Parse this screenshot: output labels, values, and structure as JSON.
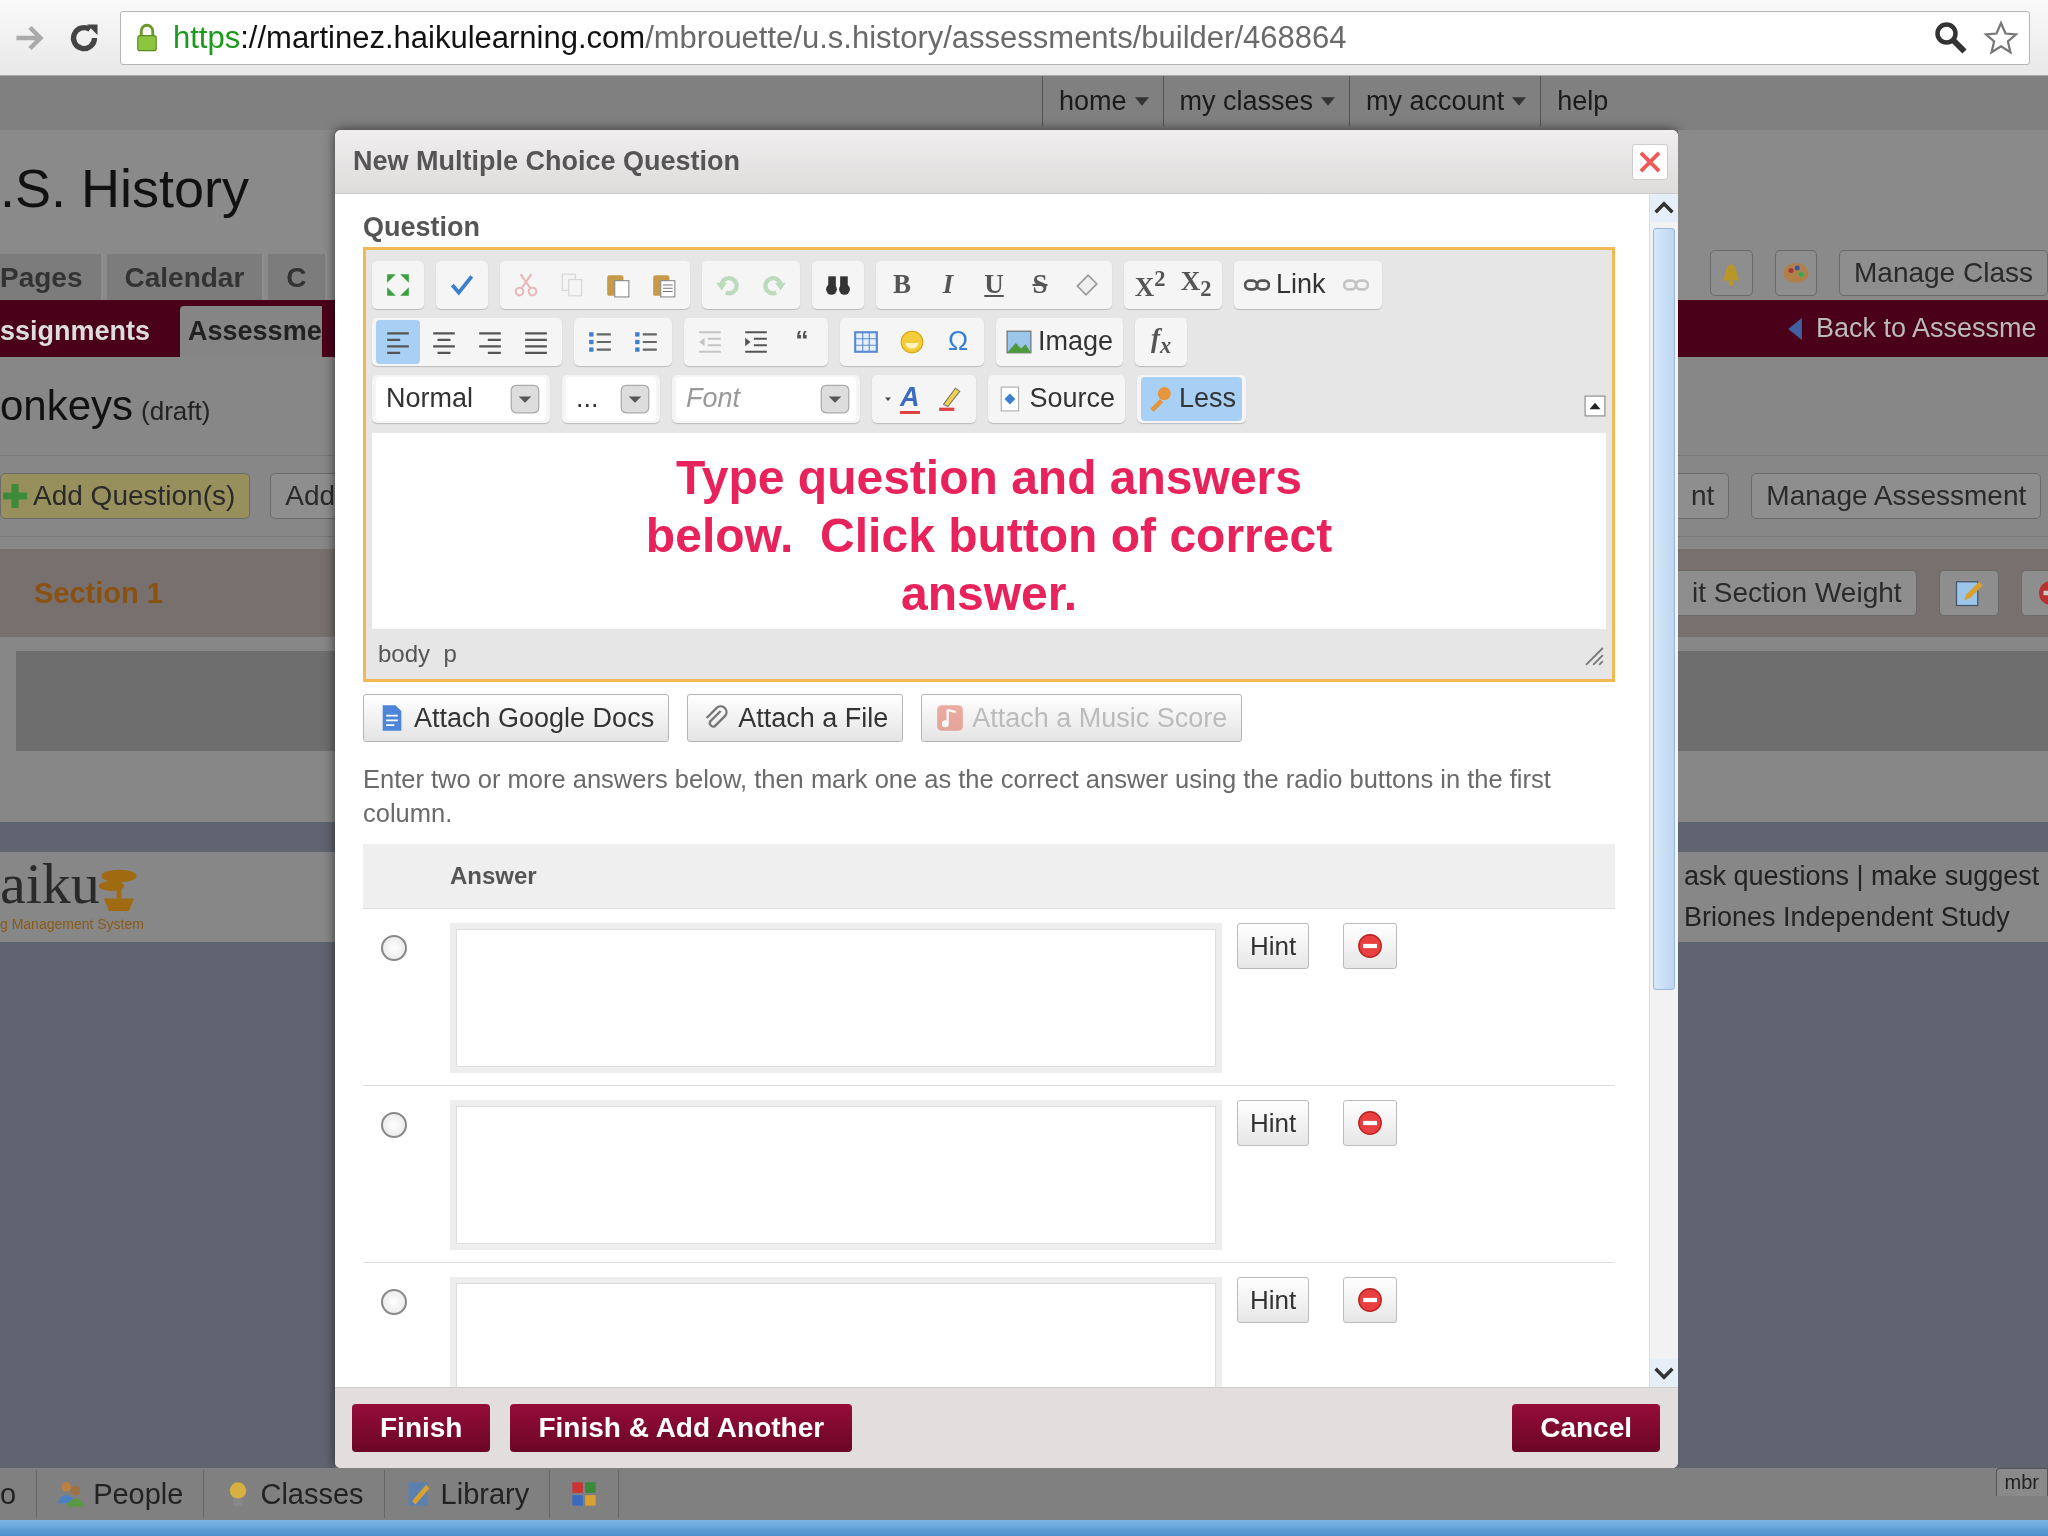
{
  "browser": {
    "url_parts": [
      {
        "text": "https",
        "kind": "scheme"
      },
      {
        "text": "://martinez.haikulearning.com",
        "kind": "host"
      },
      {
        "text": "/mbrouette/u.s.history/assessments/builder/468864",
        "kind": "path"
      }
    ]
  },
  "top_nav": [
    {
      "label": "home",
      "dropdown": true
    },
    {
      "label": "my classes",
      "dropdown": true
    },
    {
      "label": "my account",
      "dropdown": true
    },
    {
      "label": "help",
      "dropdown": false
    }
  ],
  "background": {
    "left": {
      "course_title": ".S. History",
      "tabs": [
        "Pages",
        "Calendar",
        "C"
      ],
      "subtabs": [
        {
          "label": "ssignments",
          "selected": false
        },
        {
          "label": "Assessme",
          "selected": true
        }
      ],
      "assessment_title": "onkeys",
      "status": "(draft)",
      "buttons": [
        {
          "label": "Add Question(s)",
          "kind": "add"
        },
        {
          "label": "Add",
          "kind": "plain"
        }
      ],
      "section_title": "Section 1",
      "logo_text": "aiku",
      "logo_tagline": "g Management System"
    },
    "right": {
      "manage_class": "Manage Class",
      "back_link": "Back to Assessme",
      "buttons": [
        "nt",
        "Manage Assessment"
      ],
      "section_button": "it Section Weight",
      "footer_links": "ask questions | make suggest",
      "school": "Briones Independent Study"
    }
  },
  "modal": {
    "title": "New Multiple Choice Question",
    "question_label": "Question",
    "editor": {
      "toolbar": [
        [
          {
            "items": [
              {
                "kind": "maximize",
                "disabled": false
              }
            ]
          },
          {
            "items": [
              {
                "kind": "spellcheck",
                "disabled": false
              }
            ]
          },
          {
            "items": [
              {
                "kind": "cut",
                "disabled": true
              },
              {
                "kind": "copy",
                "disabled": true
              },
              {
                "kind": "paste",
                "disabled": false
              },
              {
                "kind": "paste-text",
                "disabled": false
              }
            ]
          },
          {
            "items": [
              {
                "kind": "undo",
                "disabled": true
              },
              {
                "kind": "redo",
                "disabled": true
              }
            ]
          },
          {
            "items": [
              {
                "kind": "find",
                "disabled": false
              }
            ]
          },
          {
            "items": [
              {
                "kind": "bold",
                "label": "B",
                "disabled": false
              },
              {
                "kind": "italic",
                "label": "I",
                "disabled": false
              },
              {
                "kind": "underline",
                "label": "U",
                "disabled": false
              },
              {
                "kind": "strike",
                "label": "S",
                "disabled": false
              },
              {
                "kind": "eraser",
                "disabled": false
              }
            ]
          },
          {
            "items": [
              {
                "kind": "sup",
                "label": "X$^{2}$",
                "disabled": false
              },
              {
                "kind": "sub",
                "label": "X$_{2}$",
                "disabled": false
              }
            ]
          },
          {
            "items": [
              {
                "kind": "link",
                "label": "Link",
                "disabled": false
              },
              {
                "kind": "unlink",
                "disabled": true
              }
            ]
          }
        ],
        [
          {
            "items": [
              {
                "kind": "align-left",
                "disabled": false,
                "selected": true
              },
              {
                "kind": "align-center",
                "disabled": false,
                "selected": false
              },
              {
                "kind": "align-right",
                "disabled": false,
                "selected": false
              },
              {
                "kind": "justify",
                "disabled": false,
                "selected": false
              }
            ]
          },
          {
            "items": [
              {
                "kind": "ol",
                "disabled": false
              },
              {
                "kind": "ul",
                "disabled": false
              }
            ]
          },
          {
            "items": [
              {
                "kind": "outdent",
                "disabled": true
              },
              {
                "kind": "indent",
                "disabled": false
              },
              {
                "kind": "quote",
                "label": "“",
                "disabled": false
              }
            ]
          },
          {
            "items": [
              {
                "kind": "table",
                "disabled": false
              },
              {
                "kind": "smiley",
                "disabled": false
              },
              {
                "kind": "omega",
                "label": "Ω",
                "disabled": false
              }
            ]
          },
          {
            "items": [
              {
                "kind": "image",
                "label": "Image",
                "disabled": false
              }
            ]
          },
          {
            "items": [
              {
                "kind": "formula",
                "label": "f$_{x}$",
                "disabled": false
              }
            ]
          }
        ],
        [
          {
            "items": [
              {
                "kind": "format-select",
                "label": "Normal",
                "disabled": false
              }
            ]
          },
          {
            "items": [
              {
                "kind": "size-select",
                "label": "...",
                "disabled": false
              }
            ]
          },
          {
            "items": [
              {
                "kind": "font-select",
                "label": "Font",
                "disabled": false
              }
            ]
          },
          {
            "items": [
              {
                "kind": "text-color",
                "label": "A",
                "disabled": false
              },
              {
                "kind": "bg-color",
                "disabled": false
              }
            ]
          },
          {
            "items": [
              {
                "kind": "source",
                "label": "Source",
                "disabled": false
              }
            ]
          },
          {
            "items": [
              {
                "kind": "less",
                "label": "Less",
                "disabled": false,
                "on": true
              }
            ]
          }
        ]
      ],
      "content": "Type question and answers below.  Click button of correct answer.",
      "path": "body  p"
    },
    "attach_buttons": [
      {
        "label": "Attach Google Docs",
        "kind": "google-docs",
        "disabled": false
      },
      {
        "label": "Attach a File",
        "kind": "file",
        "disabled": false
      },
      {
        "label": "Attach a Music Score",
        "kind": "music",
        "disabled": true
      }
    ],
    "instructions": "Enter two or more answers below, then mark one as the correct answer using the radio buttons in the first column.",
    "answer_header": "Answer",
    "answers": [
      {
        "selected": false,
        "hint": "Hint"
      },
      {
        "selected": false,
        "hint": "Hint"
      },
      {
        "selected": false,
        "hint": "Hint"
      }
    ],
    "actions": [
      "Finish",
      "Finish & Add Another"
    ],
    "cancel": "Cancel"
  },
  "bottom_bar": {
    "items": [
      {
        "label": "o",
        "kind": "plain"
      },
      {
        "label": "People",
        "kind": "people"
      },
      {
        "label": "Classes",
        "kind": "classes"
      },
      {
        "label": "Library",
        "kind": "library"
      },
      {
        "kind": "apps"
      }
    ],
    "user_tab": "mbr"
  }
}
